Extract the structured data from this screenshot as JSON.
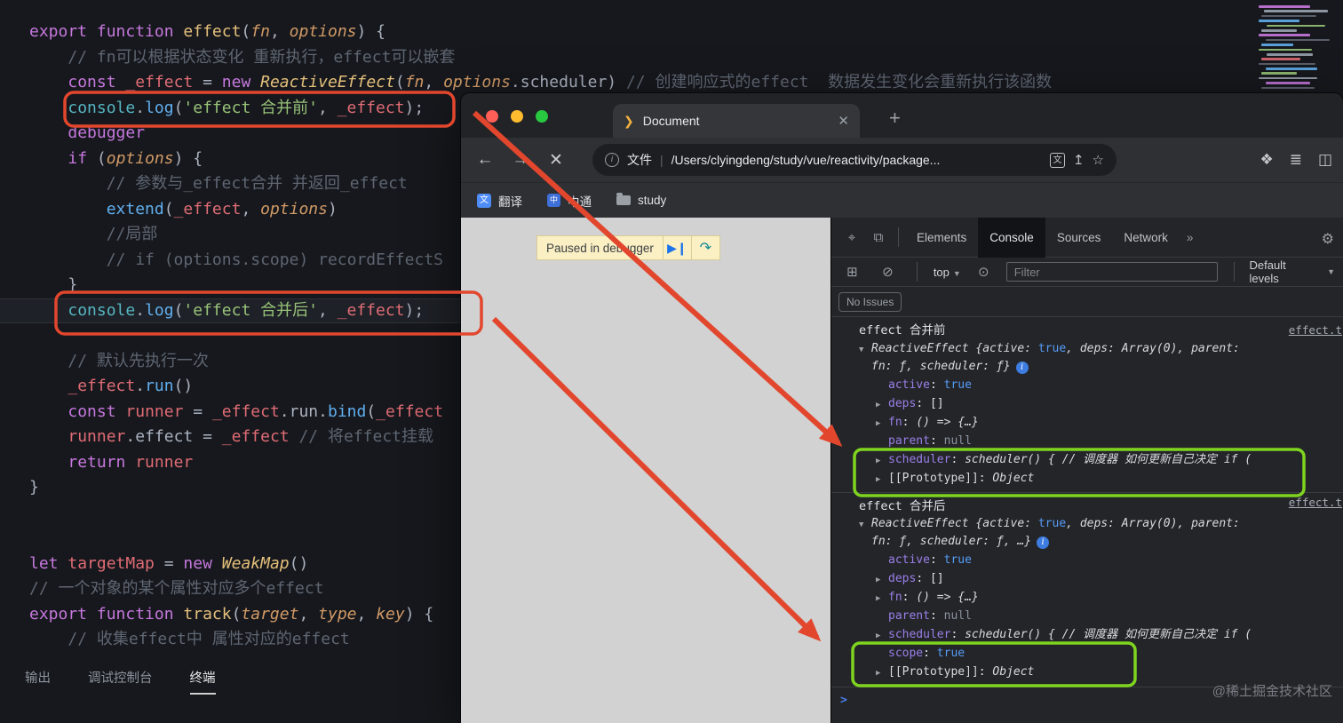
{
  "colors": {
    "annotation_red": "#e2472e",
    "annotation_green": "#7fd41f"
  },
  "editor": {
    "lines": [
      {
        "s": [
          {
            "t": "export function ",
            "c": "kw"
          },
          {
            "t": "effect",
            "c": "fn"
          },
          {
            "t": "(",
            "c": "pl"
          },
          {
            "t": "fn",
            "c": "param"
          },
          {
            "t": ", ",
            "c": "pl"
          },
          {
            "t": "options",
            "c": "param"
          },
          {
            "t": ") {",
            "c": "pl"
          }
        ]
      },
      {
        "s": [
          {
            "t": "    ",
            "c": "pl"
          },
          {
            "t": "// fn可以根据状态变化 重新执行，effect可以嵌套",
            "c": "com"
          }
        ]
      },
      {
        "s": [
          {
            "t": "    ",
            "c": "pl"
          },
          {
            "t": "const ",
            "c": "kw"
          },
          {
            "t": "_effect",
            "c": "var"
          },
          {
            "t": " = ",
            "c": "pl"
          },
          {
            "t": "new ",
            "c": "kw"
          },
          {
            "t": "ReactiveEffect",
            "c": "cls"
          },
          {
            "t": "(",
            "c": "pl"
          },
          {
            "t": "fn",
            "c": "param"
          },
          {
            "t": ", ",
            "c": "pl"
          },
          {
            "t": "options",
            "c": "param"
          },
          {
            "t": ".scheduler) ",
            "c": "pl"
          },
          {
            "t": "// 创建响应式的effect  数据发生变化会重新执行该函数",
            "c": "com"
          }
        ]
      },
      {
        "s": [
          {
            "t": "    ",
            "c": "pl"
          },
          {
            "t": "console",
            "c": "builtin"
          },
          {
            "t": ".",
            "c": "pl"
          },
          {
            "t": "log",
            "c": "meth"
          },
          {
            "t": "(",
            "c": "pl"
          },
          {
            "t": "'effect 合并前'",
            "c": "str"
          },
          {
            "t": ", ",
            "c": "pl"
          },
          {
            "t": "_effect",
            "c": "var"
          },
          {
            "t": ");",
            "c": "pl"
          }
        ]
      },
      {
        "s": [
          {
            "t": "    ",
            "c": "pl"
          },
          {
            "t": "debugger",
            "c": "kw"
          }
        ]
      },
      {
        "s": [
          {
            "t": "    ",
            "c": "pl"
          },
          {
            "t": "if",
            "c": "kw"
          },
          {
            "t": " (",
            "c": "pl"
          },
          {
            "t": "options",
            "c": "param"
          },
          {
            "t": ") {",
            "c": "pl"
          }
        ]
      },
      {
        "s": [
          {
            "t": "        ",
            "c": "pl"
          },
          {
            "t": "// 参数与_effect合并 并返回_effect",
            "c": "com"
          }
        ]
      },
      {
        "s": [
          {
            "t": "        ",
            "c": "pl"
          },
          {
            "t": "extend",
            "c": "meth"
          },
          {
            "t": "(",
            "c": "pl"
          },
          {
            "t": "_effect",
            "c": "var"
          },
          {
            "t": ", ",
            "c": "pl"
          },
          {
            "t": "options",
            "c": "param"
          },
          {
            "t": ")",
            "c": "pl"
          }
        ]
      },
      {
        "s": [
          {
            "t": "        ",
            "c": "pl"
          },
          {
            "t": "//局部",
            "c": "com"
          }
        ]
      },
      {
        "s": [
          {
            "t": "        ",
            "c": "pl"
          },
          {
            "t": "// if (options.scope) recordEffectS",
            "c": "com"
          }
        ]
      },
      {
        "s": [
          {
            "t": "    }",
            "c": "pl"
          }
        ]
      },
      {
        "hl": true,
        "s": [
          {
            "t": "    ",
            "c": "pl"
          },
          {
            "t": "console",
            "c": "builtin"
          },
          {
            "t": ".",
            "c": "pl"
          },
          {
            "t": "log",
            "c": "meth"
          },
          {
            "t": "(",
            "c": "pl"
          },
          {
            "t": "'effect 合并后'",
            "c": "str"
          },
          {
            "t": ", ",
            "c": "pl"
          },
          {
            "t": "_effect",
            "c": "var"
          },
          {
            "t": ");",
            "c": "pl"
          }
        ]
      },
      {
        "s": []
      },
      {
        "s": [
          {
            "t": "    ",
            "c": "pl"
          },
          {
            "t": "// 默认先执行一次",
            "c": "com"
          }
        ]
      },
      {
        "s": [
          {
            "t": "    ",
            "c": "pl"
          },
          {
            "t": "_effect",
            "c": "var"
          },
          {
            "t": ".",
            "c": "pl"
          },
          {
            "t": "run",
            "c": "meth"
          },
          {
            "t": "()",
            "c": "pl"
          }
        ]
      },
      {
        "s": [
          {
            "t": "    ",
            "c": "pl"
          },
          {
            "t": "const ",
            "c": "kw"
          },
          {
            "t": "runner",
            "c": "var"
          },
          {
            "t": " = ",
            "c": "pl"
          },
          {
            "t": "_effect",
            "c": "var"
          },
          {
            "t": ".run.",
            "c": "pl"
          },
          {
            "t": "bind",
            "c": "meth"
          },
          {
            "t": "(",
            "c": "pl"
          },
          {
            "t": "_effect",
            "c": "var"
          }
        ]
      },
      {
        "s": [
          {
            "t": "    ",
            "c": "pl"
          },
          {
            "t": "runner",
            "c": "var"
          },
          {
            "t": ".effect = ",
            "c": "pl"
          },
          {
            "t": "_effect",
            "c": "var"
          },
          {
            "t": " ",
            "c": "pl"
          },
          {
            "t": "// 将effect挂载",
            "c": "com"
          }
        ]
      },
      {
        "s": [
          {
            "t": "    ",
            "c": "pl"
          },
          {
            "t": "return ",
            "c": "kw"
          },
          {
            "t": "runner",
            "c": "var"
          }
        ]
      },
      {
        "s": [
          {
            "t": "}",
            "c": "pl"
          }
        ]
      },
      {
        "s": []
      },
      {
        "s": []
      },
      {
        "s": [
          {
            "t": "let ",
            "c": "kw"
          },
          {
            "t": "targetMap",
            "c": "var"
          },
          {
            "t": " = ",
            "c": "pl"
          },
          {
            "t": "new ",
            "c": "kw"
          },
          {
            "t": "WeakMap",
            "c": "cls"
          },
          {
            "t": "()",
            "c": "pl"
          }
        ]
      },
      {
        "s": [
          {
            "t": "// 一个对象的某个属性对应多个effect",
            "c": "com"
          }
        ]
      },
      {
        "s": [
          {
            "t": "export function ",
            "c": "kw"
          },
          {
            "t": "track",
            "c": "fn"
          },
          {
            "t": "(",
            "c": "pl"
          },
          {
            "t": "target",
            "c": "param"
          },
          {
            "t": ", ",
            "c": "pl"
          },
          {
            "t": "type",
            "c": "param"
          },
          {
            "t": ", ",
            "c": "pl"
          },
          {
            "t": "key",
            "c": "param"
          },
          {
            "t": ") {",
            "c": "pl"
          }
        ]
      },
      {
        "s": [
          {
            "t": "    ",
            "c": "pl"
          },
          {
            "t": "// 收集effect中 属性对应的effect",
            "c": "com"
          }
        ]
      }
    ],
    "panel_tabs": [
      {
        "label": "输出",
        "active": false
      },
      {
        "label": "调试控制台",
        "active": false
      },
      {
        "label": "终端",
        "active": true
      }
    ]
  },
  "browser": {
    "tab_title": "Document",
    "scheme": "文件",
    "url": "/Users/clyingdeng/study/vue/reactivity/package...",
    "paused_text": "Paused in debugger",
    "bookmarks": [
      {
        "label": "翻译",
        "icon": "translate-icon"
      },
      {
        "label": "中通",
        "icon": "site-icon"
      },
      {
        "label": "study",
        "icon": "folder-icon"
      }
    ]
  },
  "devtools": {
    "tabs": [
      {
        "label": "Elements",
        "active": false
      },
      {
        "label": "Console",
        "active": true
      },
      {
        "label": "Sources",
        "active": false
      },
      {
        "label": "Network",
        "active": false
      }
    ],
    "more": "»",
    "toolbar": {
      "context": "top",
      "filter_placeholder": "Filter",
      "levels": "Default levels"
    },
    "no_issues": "No Issues",
    "rows": [
      {
        "type": "head",
        "segs": [
          {
            "t": "effect 合并前",
            "c": "plain"
          }
        ],
        "link": "effect.t"
      },
      {
        "type": "preview",
        "arrow": "v",
        "segs": [
          {
            "t": "ReactiveEffect {",
            "c": "pv"
          },
          {
            "t": "active",
            "c": "pv"
          },
          {
            "t": ": ",
            "c": "pv"
          },
          {
            "t": "true",
            "c": "bool"
          },
          {
            "t": ", ",
            "c": "pv"
          },
          {
            "t": "deps",
            "c": "pv"
          },
          {
            "t": ": Array(0), ",
            "c": "pv"
          },
          {
            "t": "parent",
            "c": "pv"
          },
          {
            "t": ": ",
            "c": "pv"
          }
        ]
      },
      {
        "type": "cont",
        "segs": [
          {
            "t": "fn",
            "c": "pv"
          },
          {
            "t": ": ",
            "c": "pv"
          },
          {
            "t": "ƒ",
            "c": "pv"
          },
          {
            "t": ", ",
            "c": "pv"
          },
          {
            "t": "scheduler",
            "c": "pv"
          },
          {
            "t": ": ",
            "c": "pv"
          },
          {
            "t": "ƒ",
            "c": "pv"
          },
          {
            "t": "}",
            "c": "pv"
          }
        ],
        "info": true
      },
      {
        "type": "prop",
        "segs": [
          {
            "t": "active",
            "c": "name"
          },
          {
            "t": ": ",
            "c": "plain"
          },
          {
            "t": "true",
            "c": "bool"
          }
        ]
      },
      {
        "type": "prop",
        "arrow": ">",
        "segs": [
          {
            "t": "deps",
            "c": "name"
          },
          {
            "t": ": ",
            "c": "plain"
          },
          {
            "t": "[]",
            "c": "plain"
          }
        ]
      },
      {
        "type": "prop",
        "arrow": ">",
        "segs": [
          {
            "t": "fn",
            "c": "name"
          },
          {
            "t": ": ",
            "c": "plain"
          },
          {
            "t": "() => {…}",
            "c": "fnv"
          }
        ]
      },
      {
        "type": "prop",
        "segs": [
          {
            "t": "parent",
            "c": "name"
          },
          {
            "t": ": ",
            "c": "plain"
          },
          {
            "t": "null",
            "c": "null"
          }
        ]
      },
      {
        "type": "prop",
        "arrow": ">",
        "segs": [
          {
            "t": "scheduler",
            "c": "name"
          },
          {
            "t": ": ",
            "c": "plain"
          },
          {
            "t": "scheduler() { // 调度器 如何更新自己决定 if (",
            "c": "fnv"
          }
        ]
      },
      {
        "type": "prop",
        "arrow": ">",
        "segs": [
          {
            "t": "[[Prototype]]",
            "c": "proto"
          },
          {
            "t": ": ",
            "c": "plain"
          },
          {
            "t": "Object",
            "c": "fnv"
          }
        ]
      },
      {
        "type": "head",
        "sep": true,
        "segs": [
          {
            "t": "effect 合并后",
            "c": "plain"
          }
        ],
        "link": "effect.t"
      },
      {
        "type": "preview",
        "arrow": "v",
        "segs": [
          {
            "t": "ReactiveEffect {",
            "c": "pv"
          },
          {
            "t": "active",
            "c": "pv"
          },
          {
            "t": ": ",
            "c": "pv"
          },
          {
            "t": "true",
            "c": "bool"
          },
          {
            "t": ", ",
            "c": "pv"
          },
          {
            "t": "deps",
            "c": "pv"
          },
          {
            "t": ": Array(0), ",
            "c": "pv"
          },
          {
            "t": "parent",
            "c": "pv"
          },
          {
            "t": ": ",
            "c": "pv"
          }
        ]
      },
      {
        "type": "cont",
        "segs": [
          {
            "t": "fn",
            "c": "pv"
          },
          {
            "t": ": ",
            "c": "pv"
          },
          {
            "t": "ƒ",
            "c": "pv"
          },
          {
            "t": ", ",
            "c": "pv"
          },
          {
            "t": "scheduler",
            "c": "pv"
          },
          {
            "t": ": ",
            "c": "pv"
          },
          {
            "t": "ƒ",
            "c": "pv"
          },
          {
            "t": ", …}",
            "c": "pv"
          }
        ],
        "info": true
      },
      {
        "type": "prop",
        "segs": [
          {
            "t": "active",
            "c": "name"
          },
          {
            "t": ": ",
            "c": "plain"
          },
          {
            "t": "true",
            "c": "bool"
          }
        ]
      },
      {
        "type": "prop",
        "arrow": ">",
        "segs": [
          {
            "t": "deps",
            "c": "name"
          },
          {
            "t": ": ",
            "c": "plain"
          },
          {
            "t": "[]",
            "c": "plain"
          }
        ]
      },
      {
        "type": "prop",
        "arrow": ">",
        "segs": [
          {
            "t": "fn",
            "c": "name"
          },
          {
            "t": ": ",
            "c": "plain"
          },
          {
            "t": "() => {…}",
            "c": "fnv"
          }
        ]
      },
      {
        "type": "prop",
        "segs": [
          {
            "t": "parent",
            "c": "name"
          },
          {
            "t": ": ",
            "c": "plain"
          },
          {
            "t": "null",
            "c": "null"
          }
        ]
      },
      {
        "type": "prop",
        "arrow": ">",
        "segs": [
          {
            "t": "scheduler",
            "c": "name"
          },
          {
            "t": ": ",
            "c": "plain"
          },
          {
            "t": "scheduler() { // 调度器 如何更新自己决定 if (",
            "c": "fnv"
          }
        ]
      },
      {
        "type": "prop",
        "segs": [
          {
            "t": "scope",
            "c": "name"
          },
          {
            "t": ": ",
            "c": "plain"
          },
          {
            "t": "true",
            "c": "bool"
          }
        ]
      },
      {
        "type": "prop",
        "arrow": ">",
        "segs": [
          {
            "t": "[[Prototype]]",
            "c": "proto"
          },
          {
            "t": ": ",
            "c": "plain"
          },
          {
            "t": "Object",
            "c": "fnv"
          }
        ]
      },
      {
        "type": "prompt",
        "segs": [
          {
            "t": ">",
            "c": "prompt"
          }
        ]
      }
    ]
  },
  "watermark": "@稀土掘金技术社区"
}
